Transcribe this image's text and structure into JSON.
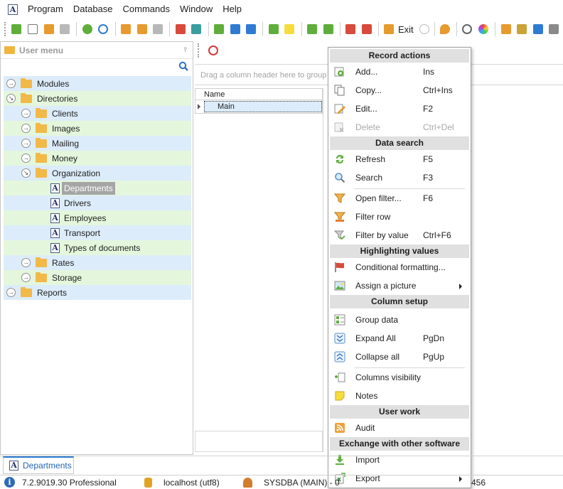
{
  "menubar": {
    "items": [
      "Program",
      "Database",
      "Commands",
      "Window",
      "Help"
    ]
  },
  "toolbar": {
    "exit_label": "Exit"
  },
  "left_panel": {
    "title": "User menu",
    "tree": [
      {
        "label": "Modules"
      },
      {
        "label": "Directories"
      },
      {
        "label": "Clients"
      },
      {
        "label": "Images"
      },
      {
        "label": "Mailing"
      },
      {
        "label": "Money"
      },
      {
        "label": "Organization"
      },
      {
        "label": "Departments"
      },
      {
        "label": "Drivers"
      },
      {
        "label": "Employees"
      },
      {
        "label": "Transport"
      },
      {
        "label": "Types of documents"
      },
      {
        "label": "Rates"
      },
      {
        "label": "Storage"
      },
      {
        "label": "Reports"
      }
    ]
  },
  "grid": {
    "group_hint": "Drag a column header here to group b",
    "column_header": "Name",
    "row_value": "Main"
  },
  "context_menu": {
    "record_actions": {
      "header": "Record actions",
      "add": {
        "label": "Add...",
        "shortcut": "Ins"
      },
      "copy": {
        "label": "Copy...",
        "shortcut": "Ctrl+Ins"
      },
      "edit": {
        "label": "Edit...",
        "shortcut": "F2"
      },
      "delete": {
        "label": "Delete",
        "shortcut": "Ctrl+Del"
      }
    },
    "data_search": {
      "header": "Data search",
      "refresh": {
        "label": "Refresh",
        "shortcut": "F5"
      },
      "search": {
        "label": "Search",
        "shortcut": "F3"
      },
      "open_filter": {
        "label": "Open filter...",
        "shortcut": "F6"
      },
      "filter_row": {
        "label": "Filter row",
        "shortcut": ""
      },
      "filter_by_value": {
        "label": "Filter by value",
        "shortcut": "Ctrl+F6"
      }
    },
    "highlighting": {
      "header": "Highlighting values",
      "conditional_formatting": {
        "label": "Conditional formatting..."
      },
      "assign_picture": {
        "label": "Assign a picture"
      }
    },
    "column_setup": {
      "header": "Column setup",
      "group_data": {
        "label": "Group data",
        "shortcut": ""
      },
      "expand_all": {
        "label": "Expand All",
        "shortcut": "PgDn"
      },
      "collapse_all": {
        "label": "Collapse all",
        "shortcut": "PgUp"
      },
      "columns_visibility": {
        "label": "Columns visibility",
        "shortcut": ""
      },
      "notes": {
        "label": "Notes",
        "shortcut": ""
      }
    },
    "user_work": {
      "header": "User work",
      "audit": {
        "label": "Audit"
      }
    },
    "exchange": {
      "header": "Exchange with other software",
      "import": {
        "label": "Import"
      },
      "export": {
        "label": "Export"
      }
    }
  },
  "tabs": {
    "active": "Departments"
  },
  "statusbar": {
    "version": "7.2.9019.30 Professional",
    "server": "localhost (utf8)",
    "user": "SYSDBA (MAIN) - 0",
    "tail": "456"
  }
}
